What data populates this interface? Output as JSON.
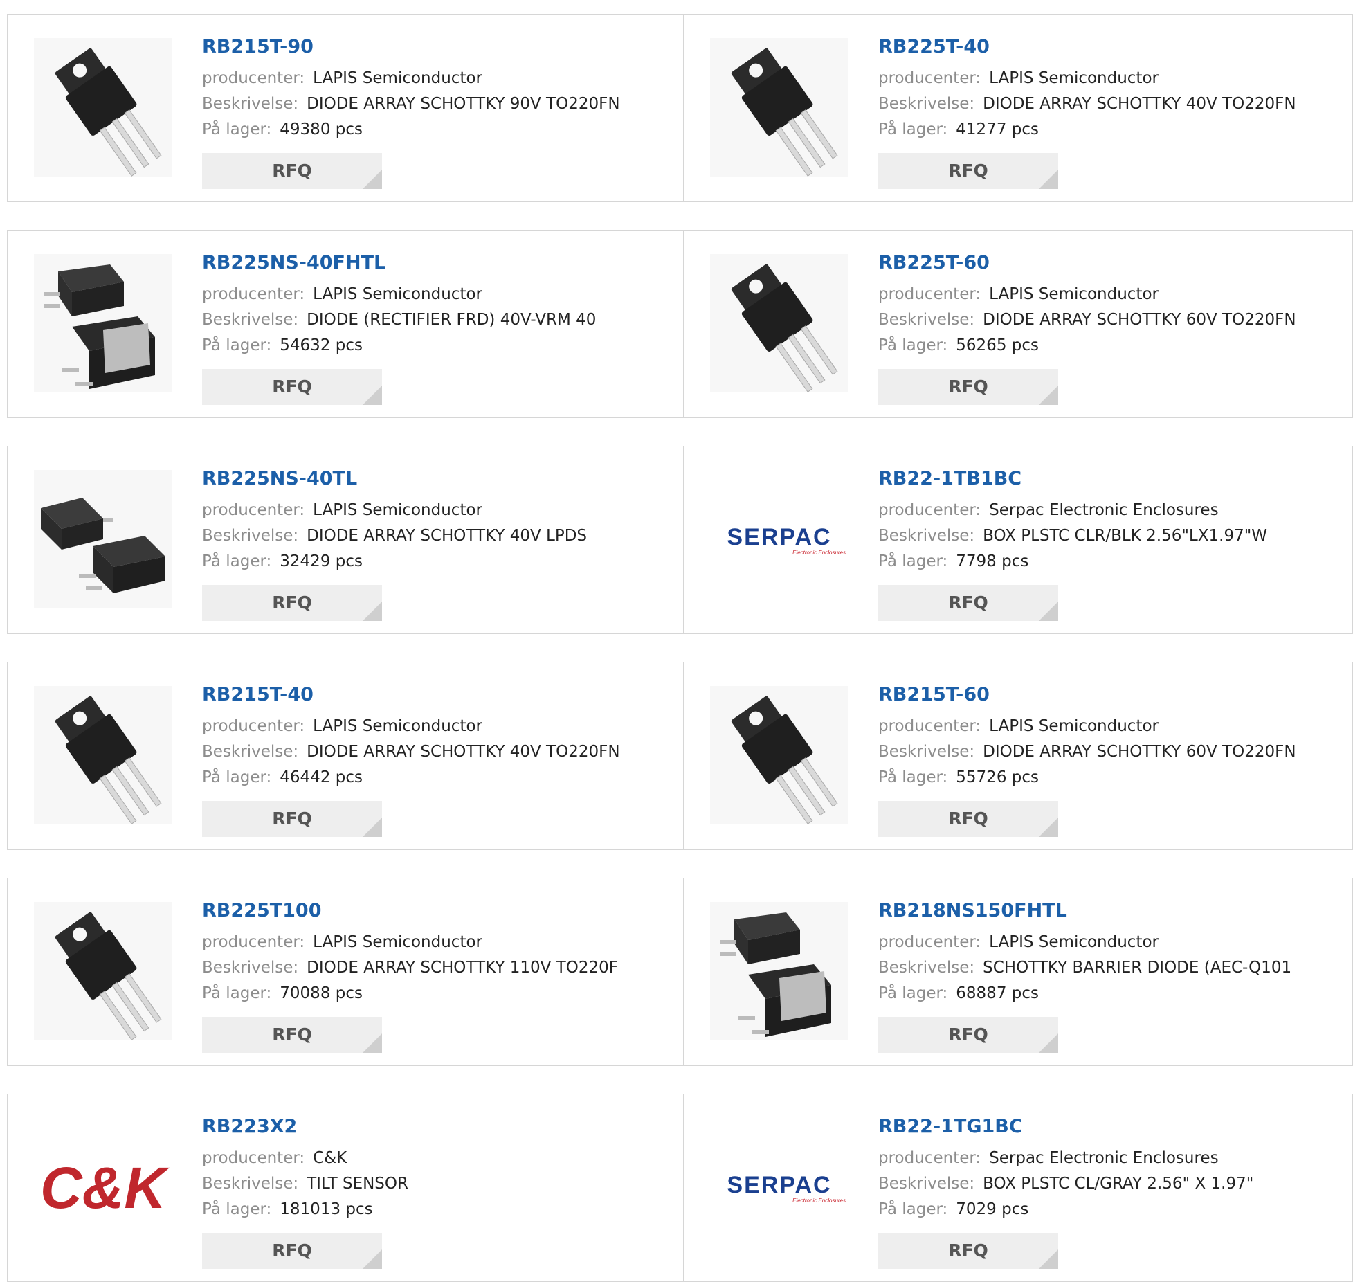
{
  "labels": {
    "manufacturer": "producenter:",
    "description": "Beskrivelse:",
    "stock": "På lager:",
    "rfq": "RFQ"
  },
  "rows": [
    [
      {
        "part": "RB215T-90",
        "manufacturer": "LAPIS Semiconductor",
        "description": "DIODE ARRAY SCHOTTKY 90V TO220FN",
        "stock": "49380 pcs",
        "image": "to220-package-icon"
      },
      {
        "part": "RB225T-40",
        "manufacturer": "LAPIS Semiconductor",
        "description": "DIODE ARRAY SCHOTTKY 40V TO220FN",
        "stock": "41277 pcs",
        "image": "to220-package-icon"
      }
    ],
    [
      {
        "part": "RB225NS-40FHTL",
        "manufacturer": "LAPIS Semiconductor",
        "description": "DIODE (RECTIFIER FRD) 40V-VRM 40",
        "stock": "54632 pcs",
        "image": "dpak-package-icon"
      },
      {
        "part": "RB225T-60",
        "manufacturer": "LAPIS Semiconductor",
        "description": "DIODE ARRAY SCHOTTKY 60V TO220FN",
        "stock": "56265 pcs",
        "image": "to220-package-icon"
      }
    ],
    [
      {
        "part": "RB225NS-40TL",
        "manufacturer": "LAPIS Semiconductor",
        "description": "DIODE ARRAY SCHOTTKY 40V LPDS",
        "stock": "32429 pcs",
        "image": "lpds-package-icon"
      },
      {
        "part": "RB22-1TB1BC",
        "manufacturer": "Serpac Electronic Enclosures",
        "description": "BOX PLSTC CLR/BLK 2.56\"LX1.97\"W",
        "stock": "7798 pcs",
        "image": "serpac-logo"
      }
    ],
    [
      {
        "part": "RB215T-40",
        "manufacturer": "LAPIS Semiconductor",
        "description": "DIODE ARRAY SCHOTTKY 40V TO220FN",
        "stock": "46442 pcs",
        "image": "to220-package-icon"
      },
      {
        "part": "RB215T-60",
        "manufacturer": "LAPIS Semiconductor",
        "description": "DIODE ARRAY SCHOTTKY 60V TO220FN",
        "stock": "55726 pcs",
        "image": "to220-package-icon"
      }
    ],
    [
      {
        "part": "RB225T100",
        "manufacturer": "LAPIS Semiconductor",
        "description": "DIODE ARRAY SCHOTTKY 110V TO220F",
        "stock": "70088 pcs",
        "image": "to220-package-icon"
      },
      {
        "part": "RB218NS150FHTL",
        "manufacturer": "LAPIS Semiconductor",
        "description": "SCHOTTKY BARRIER DIODE (AEC-Q101",
        "stock": "68887 pcs",
        "image": "dpak-package-icon"
      }
    ],
    [
      {
        "part": "RB223X2",
        "manufacturer": "C&K",
        "description": "TILT SENSOR",
        "stock": "181013 pcs",
        "image": "ck-logo"
      },
      {
        "part": "RB22-1TG1BC",
        "manufacturer": "Serpac Electronic Enclosures",
        "description": "BOX PLSTC CL/GRAY 2.56\" X 1.97\"",
        "stock": "7029 pcs",
        "image": "serpac-logo"
      }
    ]
  ],
  "logos": {
    "serpac": {
      "word": "SERPAC",
      "tagline": "Electronic Enclosures",
      "color": "#1a3f8f",
      "tagline_color": "#c8202a"
    },
    "ck": {
      "word": "C&K",
      "color": "#c0272d"
    }
  },
  "colors": {
    "part_link": "#1c5fa8",
    "label": "#8c8c8c",
    "rfq_bg": "#eeeeee"
  }
}
